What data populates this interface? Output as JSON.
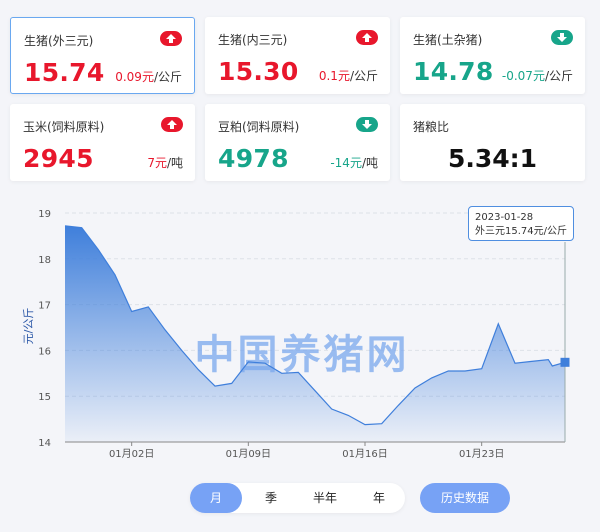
{
  "cards": [
    {
      "label": "生猪(外三元)",
      "price": "15.74",
      "change": "0.09元",
      "unit": "/公斤",
      "trend": "up",
      "icon": "arrow-up-icon"
    },
    {
      "label": "生猪(内三元)",
      "price": "15.30",
      "change": "0.1元",
      "unit": "/公斤",
      "trend": "up",
      "icon": "arrow-up-icon"
    },
    {
      "label": "生猪(土杂猪)",
      "price": "14.78",
      "change": "-0.07元",
      "unit": "/公斤",
      "trend": "down",
      "icon": "arrow-down-icon"
    },
    {
      "label": "玉米(饲料原料)",
      "price": "2945",
      "change": "7元",
      "unit": "/吨",
      "trend": "up",
      "icon": "arrow-up-icon"
    },
    {
      "label": "豆粕(饲料原料)",
      "price": "4978",
      "change": "-14元",
      "unit": "/吨",
      "trend": "down",
      "icon": "arrow-down-icon"
    },
    {
      "label": "猪粮比",
      "price": "5.34:1"
    }
  ],
  "colors": {
    "up": "#e8172c",
    "down": "#17a58a",
    "accent": "#77a2f5",
    "line": "#3f7fdb"
  },
  "watermark": "中国养猪网",
  "tooltip": {
    "date": "2023-01-28",
    "text": "外三元15.74元/公斤"
  },
  "chart_data": {
    "type": "area",
    "ylabel": "元/公斤",
    "ylim": [
      14,
      19
    ],
    "yticks": [
      14,
      15,
      16,
      17,
      18,
      19
    ],
    "x_start": "2022-12-29",
    "x_end": "2023-01-28",
    "xticks": [
      {
        "date": "2023-01-02",
        "label": "01月02日"
      },
      {
        "date": "2023-01-09",
        "label": "01月09日"
      },
      {
        "date": "2023-01-16",
        "label": "01月16日"
      },
      {
        "date": "2023-01-23",
        "label": "01月23日"
      }
    ],
    "series": [
      {
        "values": [
          [
            "2022-12-29",
            18.72
          ],
          [
            "2022-12-30",
            18.68
          ],
          [
            "2022-12-31",
            18.2
          ],
          [
            "2023-01-01",
            17.65
          ],
          [
            "2023-01-02",
            16.85
          ],
          [
            "2023-01-03",
            16.95
          ],
          [
            "2023-01-04",
            16.45
          ],
          [
            "2023-01-05",
            16.0
          ],
          [
            "2023-01-06",
            15.58
          ],
          [
            "2023-01-07",
            15.22
          ],
          [
            "2023-01-08",
            15.28
          ],
          [
            "2023-01-09",
            15.75
          ],
          [
            "2023-01-10",
            15.72
          ],
          [
            "2023-01-11",
            15.5
          ],
          [
            "2023-01-12",
            15.52
          ],
          [
            "2023-01-13",
            15.12
          ],
          [
            "2023-01-14",
            14.72
          ],
          [
            "2023-01-15",
            14.58
          ],
          [
            "2023-01-16",
            14.38
          ],
          [
            "2023-01-17",
            14.4
          ],
          [
            "2023-01-18",
            14.8
          ],
          [
            "2023-01-19",
            15.18
          ],
          [
            "2023-01-20",
            15.4
          ],
          [
            "2023-01-21",
            15.55
          ],
          [
            "2023-01-22",
            15.55
          ],
          [
            "2023-01-23",
            15.6
          ],
          [
            "2023-01-24",
            16.58
          ],
          [
            "2023-01-25",
            15.72
          ],
          [
            "2023-01-26",
            15.76
          ],
          [
            "2023-01-27",
            15.8
          ],
          [
            "2023-01-27",
            15.66
          ],
          [
            "2023-01-28",
            15.74
          ]
        ]
      }
    ],
    "grid": true
  },
  "period": {
    "tabs": [
      "月",
      "季",
      "半年",
      "年"
    ],
    "active": 0
  },
  "history_button": "历史数据"
}
